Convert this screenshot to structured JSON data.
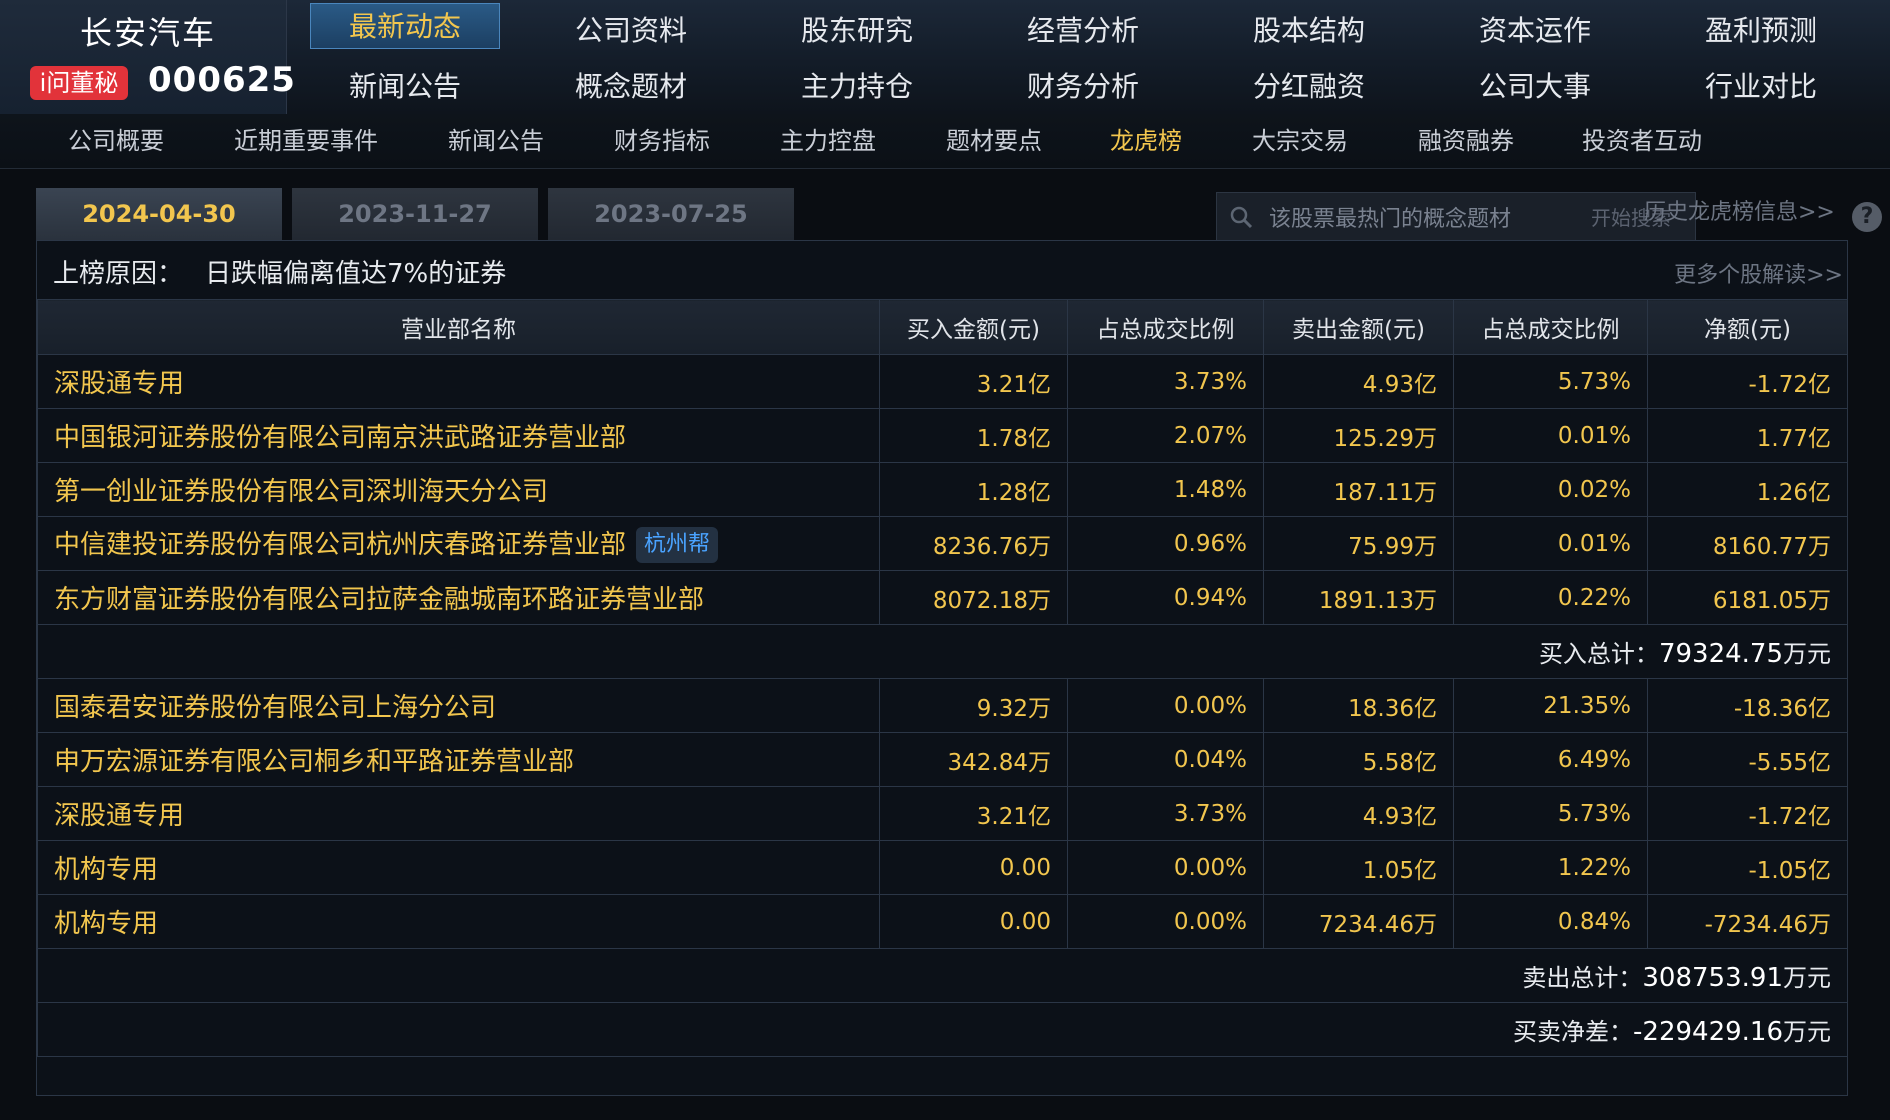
{
  "header": {
    "stock_name": "长安汽车",
    "badge": "i问董秘",
    "stock_code": "000625",
    "main_nav_row1": [
      "最新动态",
      "公司资料",
      "股东研究",
      "经营分析",
      "股本结构",
      "资本运作",
      "盈利预测"
    ],
    "main_nav_row2": [
      "新闻公告",
      "概念题材",
      "主力持仓",
      "财务分析",
      "分红融资",
      "公司大事",
      "行业对比"
    ],
    "active_main_nav": "最新动态"
  },
  "subnav": {
    "items": [
      "公司概要",
      "近期重要事件",
      "新闻公告",
      "财务指标",
      "主力控盘",
      "题材要点",
      "龙虎榜",
      "大宗交易",
      "融资融券",
      "投资者互动"
    ],
    "active": "龙虎榜"
  },
  "tabs": {
    "dates": [
      "2024-04-30",
      "2023-11-27",
      "2023-07-25"
    ],
    "active": "2024-04-30"
  },
  "search": {
    "placeholder": "该股票最热门的概念题材",
    "button_label": "开始搜索",
    "history_link": "历史龙虎榜信息>>"
  },
  "reason": {
    "label": "上榜原因：",
    "text": "日跌幅偏离值达7%的证券",
    "more_link": "更多个股解读>>"
  },
  "table": {
    "columns": [
      "营业部名称",
      "买入金额(元)",
      "占总成交比例",
      "卖出金额(元)",
      "占总成交比例",
      "净额(元)"
    ],
    "buy_rows": [
      {
        "name": "深股通专用",
        "buy": "3.21亿",
        "buy_pct": "3.73%",
        "sell": "4.93亿",
        "sell_pct": "5.73%",
        "net": "-1.72亿",
        "tag": ""
      },
      {
        "name": "中国银河证券股份有限公司南京洪武路证券营业部",
        "buy": "1.78亿",
        "buy_pct": "2.07%",
        "sell": "125.29万",
        "sell_pct": "0.01%",
        "net": "1.77亿",
        "tag": ""
      },
      {
        "name": "第一创业证券股份有限公司深圳海天分公司",
        "buy": "1.28亿",
        "buy_pct": "1.48%",
        "sell": "187.11万",
        "sell_pct": "0.02%",
        "net": "1.26亿",
        "tag": ""
      },
      {
        "name": "中信建投证券股份有限公司杭州庆春路证券营业部",
        "buy": "8236.76万",
        "buy_pct": "0.96%",
        "sell": "75.99万",
        "sell_pct": "0.01%",
        "net": "8160.77万",
        "tag": "杭州帮"
      },
      {
        "name": "东方财富证券股份有限公司拉萨金融城南环路证券营业部",
        "buy": "8072.18万",
        "buy_pct": "0.94%",
        "sell": "1891.13万",
        "sell_pct": "0.22%",
        "net": "6181.05万",
        "tag": ""
      }
    ],
    "buy_total_label": "买入总计：",
    "buy_total_value": "79324.75",
    "buy_total_unit": "万元",
    "sell_rows": [
      {
        "name": "国泰君安证券股份有限公司上海分公司",
        "buy": "9.32万",
        "buy_pct": "0.00%",
        "sell": "18.36亿",
        "sell_pct": "21.35%",
        "net": "-18.36亿"
      },
      {
        "name": "申万宏源证券有限公司桐乡和平路证券营业部",
        "buy": "342.84万",
        "buy_pct": "0.04%",
        "sell": "5.58亿",
        "sell_pct": "6.49%",
        "net": "-5.55亿"
      },
      {
        "name": "深股通专用",
        "buy": "3.21亿",
        "buy_pct": "3.73%",
        "sell": "4.93亿",
        "sell_pct": "5.73%",
        "net": "-1.72亿"
      },
      {
        "name": "机构专用",
        "buy": "0.00",
        "buy_pct": "0.00%",
        "sell": "1.05亿",
        "sell_pct": "1.22%",
        "net": "-1.05亿"
      },
      {
        "name": "机构专用",
        "buy": "0.00",
        "buy_pct": "0.00%",
        "sell": "7234.46万",
        "sell_pct": "0.84%",
        "net": "-7234.46万"
      }
    ],
    "sell_total_label": "卖出总计：",
    "sell_total_value": "308753.91",
    "sell_total_unit": "万元",
    "net_label": "买卖净差：",
    "net_value": "-229429.16",
    "net_unit": "万元"
  }
}
